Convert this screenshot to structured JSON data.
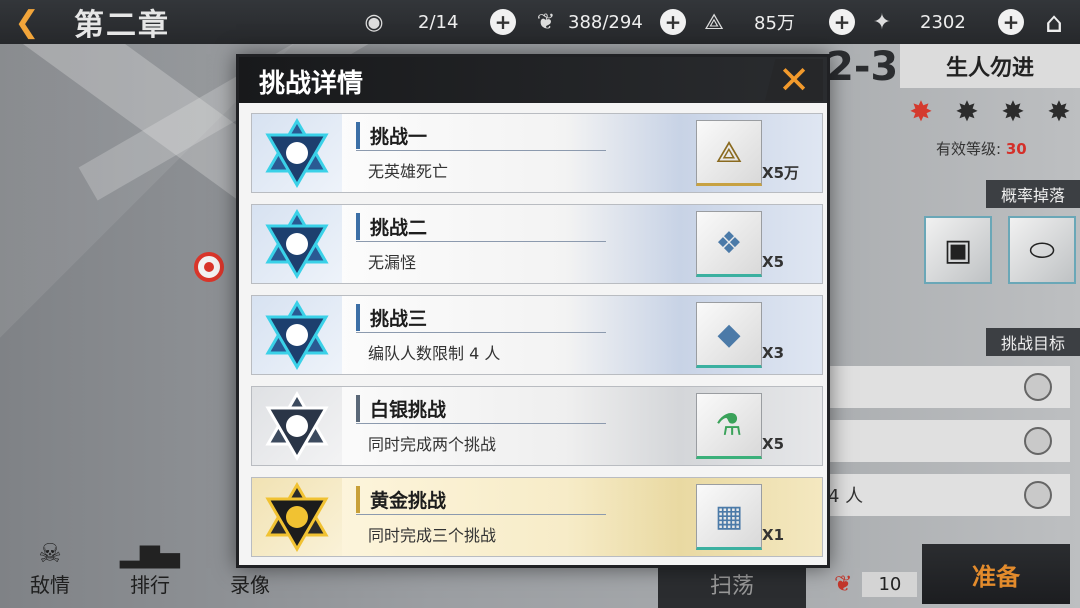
{
  "header": {
    "chapter_title": "第二章",
    "stats": [
      {
        "icon": "eye-icon",
        "value": "2/14"
      },
      {
        "icon": "heart-icon",
        "value": "388/294"
      },
      {
        "icon": "triangle-crystal-icon",
        "value": "85万"
      },
      {
        "icon": "star-shard-icon",
        "value": "2302"
      }
    ]
  },
  "stage": {
    "code": "2-3",
    "name": "生人勿进",
    "stars_earned": 1,
    "stars_total": 4,
    "effective_level_label": "有效等级:",
    "effective_level_value": "30",
    "drop_title": "概率掉落",
    "drops": [
      {
        "icon": "supply-box-icon"
      },
      {
        "icon": "exp-capsule-icon"
      }
    ],
    "objectives_title": "挑战目标",
    "objective_partial_text": "4 人"
  },
  "modal": {
    "title": "挑战详情",
    "challenges": [
      {
        "title": "挑战一",
        "desc": "无英雄死亡",
        "reward_icon": "triangle-crystal-icon",
        "qty": "X5万",
        "tier": "blue"
      },
      {
        "title": "挑战二",
        "desc": "无漏怪",
        "reward_icon": "cube-tiles-icon",
        "qty": "X5",
        "tier": "blue"
      },
      {
        "title": "挑战三",
        "desc": "编队人数限制 4 人",
        "reward_icon": "crystal-cube-icon",
        "qty": "X3",
        "tier": "blue"
      },
      {
        "title": "白银挑战",
        "desc": "同时完成两个挑战",
        "reward_icon": "flask-icon",
        "qty": "X5",
        "tier": "silver"
      },
      {
        "title": "黄金挑战",
        "desc": "同时完成三个挑战",
        "reward_icon": "rubik-cube-icon",
        "qty": "X1",
        "tier": "gold"
      }
    ]
  },
  "bottom_nav": [
    {
      "label": "敌情",
      "icon": "skull-icon"
    },
    {
      "label": "排行",
      "icon": "bar-chart-icon"
    },
    {
      "label": "录像",
      "icon": "video-icon"
    }
  ],
  "actions": {
    "sweep_label": "扫荡",
    "cost_value": "10",
    "ready_label": "准备"
  },
  "colors": {
    "accent_orange": "#f29a2c",
    "star_red": "#d43a2e",
    "badge_blue": "#1d3f6e",
    "badge_gold": "#c8a038"
  }
}
